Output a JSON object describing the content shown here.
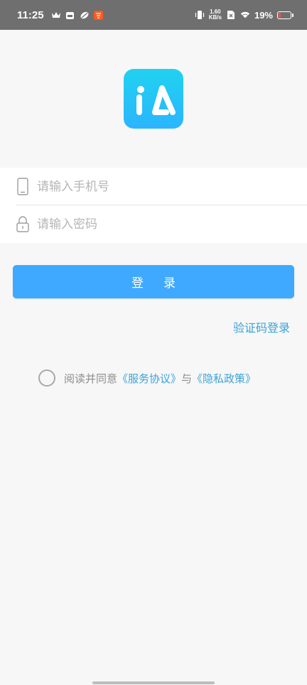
{
  "status_bar": {
    "time": "11:25",
    "net_speed_value": "1.60",
    "net_speed_unit": "KB/s",
    "battery_percent": "19%",
    "battery_level": 0.19,
    "icons": [
      "crown-icon",
      "calendar-icon",
      "leaf-icon",
      "app-badge-icon",
      "vibrate-icon",
      "sim-x-icon",
      "wifi-icon",
      "battery-icon"
    ]
  },
  "login": {
    "logo_icon": "ia-app-logo",
    "phone_placeholder": "请输入手机号",
    "password_placeholder": "请输入密码",
    "login_button": "登录",
    "sms_login_link": "验证码登录",
    "agreement_prefix": "阅读并同意",
    "service_agreement": "《服务协议》",
    "conjunction": "与",
    "privacy_policy": "《隐私政策》"
  },
  "colors": {
    "status_bar": "#6f6f6f",
    "background": "#f7f7f7",
    "primary_button": "#3fa9ff",
    "link": "#3aa3d8",
    "logo_gradient_top": "#20d2ef",
    "logo_gradient_bottom": "#2bb5ff"
  }
}
